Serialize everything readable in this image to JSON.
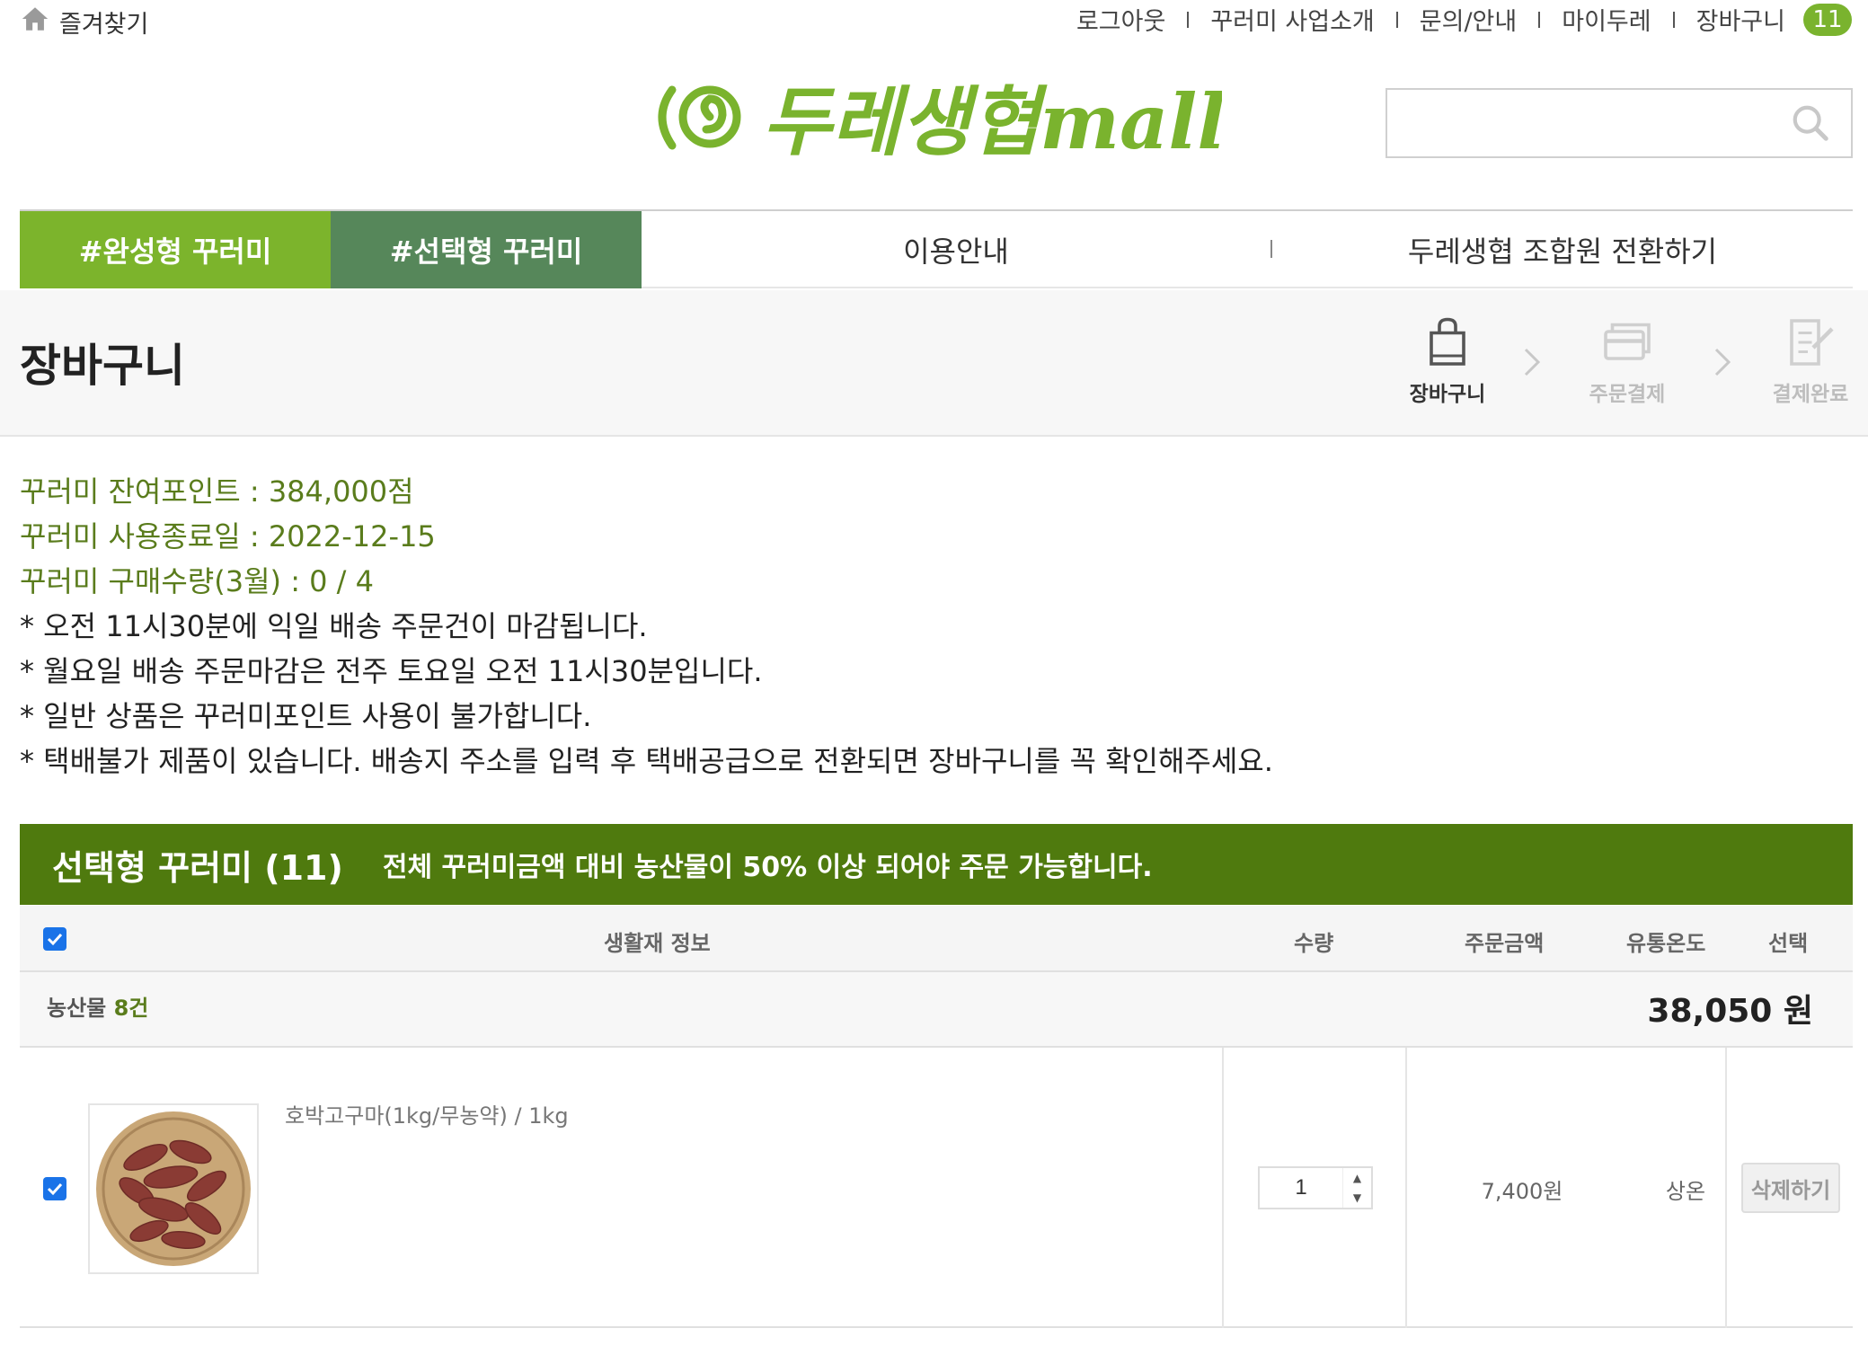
{
  "topbar": {
    "favorites_label": "즐겨찾기",
    "links": [
      "로그아웃",
      "꾸러미 사업소개",
      "문의/안내",
      "마이두레",
      "장바구니"
    ],
    "cart_count": "11"
  },
  "logo": {
    "text": "두레생협mall",
    "brand_color": "#7ab32e"
  },
  "search": {
    "placeholder": "",
    "icon": "search-icon"
  },
  "nav": {
    "tabs": [
      "#완성형 꾸러미",
      "#선택형 꾸러미",
      "이용안내",
      "두레생협 조합원 전환하기"
    ]
  },
  "page": {
    "title": "장바구니",
    "steps": [
      {
        "label": "장바구니",
        "icon": "shopping-bag-icon",
        "active": true
      },
      {
        "label": "주문결제",
        "icon": "credit-card-icon",
        "active": false
      },
      {
        "label": "결제완료",
        "icon": "checklist-icon",
        "active": false
      }
    ]
  },
  "info": {
    "green_lines": [
      "꾸러미 잔여포인트 : 384,000점",
      "꾸러미 사용종료일 : 2022-12-15",
      "꾸러미 구매수량(3월) : 0 / 4"
    ],
    "notes": [
      "* 오전 11시30분에 익일 배송 주문건이 마감됩니다.",
      "* 월요일 배송 주문마감은 전주 토요일 오전 11시30분입니다.",
      "* 일반 상품은 꾸러미포인트 사용이 불가합니다.",
      "* 택배불가 제품이 있습니다. 배송지 주소를 입력 후 택배공급으로 전환되면 장바구니를 꼭 확인해주세요."
    ]
  },
  "section": {
    "title": "선택형 꾸러미 (11)",
    "notice": "전체 꾸러미금액 대비 농산물이 50% 이상 되어야 주문 가능합니다.",
    "color": "#4f7a0e"
  },
  "table": {
    "headers": [
      "생활재 정보",
      "수량",
      "주문금액",
      "유통온도",
      "선택"
    ],
    "select_all_checked": true
  },
  "group": {
    "label": "농산물",
    "count": "8건",
    "total": "38,050 원"
  },
  "items": [
    {
      "name": "호박고구마(1kg/무농약)  /  1kg",
      "quantity": "1",
      "price": "7,400원",
      "temperature": "상온",
      "delete_label": "삭제하기",
      "checked": true
    }
  ]
}
